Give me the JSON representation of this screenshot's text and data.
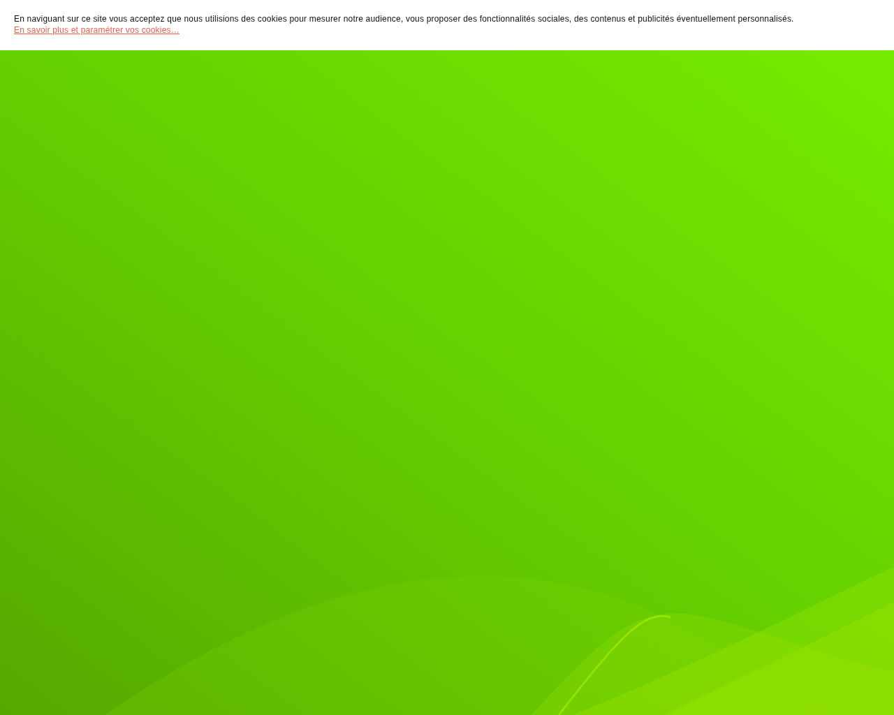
{
  "cookie_banner": {
    "message": "En naviguant sur ce site vous acceptez que nous utilisions des cookies pour mesurer notre audience, vous proposer des fonctionnalités sociales, des contenus et publicités éventuellement personnalisés.",
    "link": "En savoir plus et paramétrer vos cookies…"
  }
}
